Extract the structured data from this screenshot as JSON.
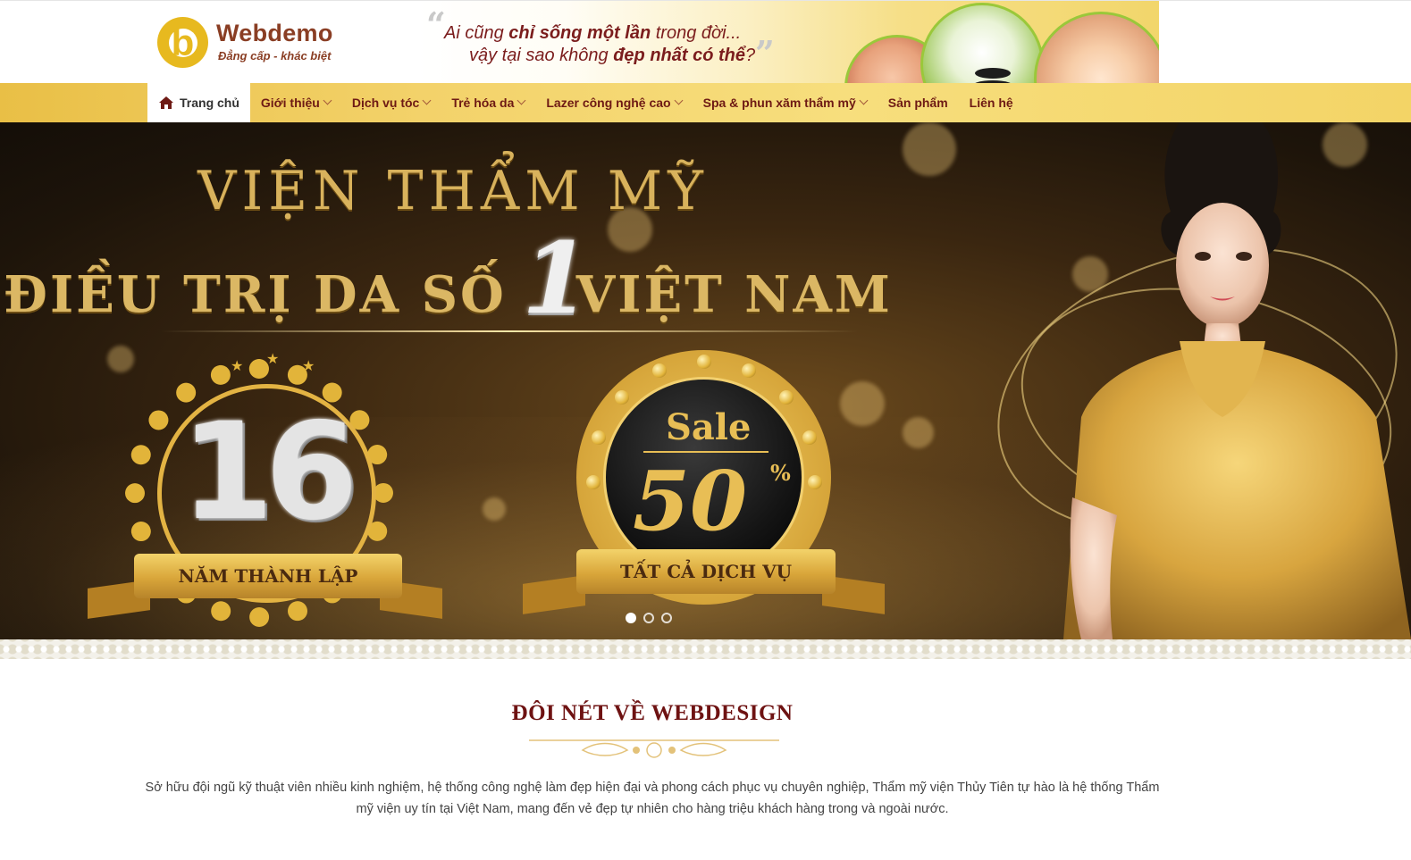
{
  "colors": {
    "brand_brown": "#8a3e24",
    "gold": "#e7b91f",
    "nav_text": "#6e1a14",
    "title_red": "#6e1212"
  },
  "header": {
    "logo_letter": "b",
    "logo_name": "Webdemo",
    "logo_slogan": "Đẳng cấp - khác biệt",
    "quote": {
      "open_mark": "“",
      "line1_a": "Ai cũng ",
      "line1_b": "chỉ sống một lần",
      "line1_c": " trong đời...",
      "line2_a": "vậy tại sao không ",
      "line2_b": "đẹp nhất có thể",
      "line2_c": "?",
      "close_mark": "”"
    }
  },
  "nav": {
    "items": [
      {
        "label": "Trang chủ",
        "icon": "home-icon",
        "active": true,
        "dropdown": false
      },
      {
        "label": "Giới thiệu",
        "active": false,
        "dropdown": true
      },
      {
        "label": "Dịch vụ tóc",
        "active": false,
        "dropdown": true
      },
      {
        "label": "Trẻ hóa da",
        "active": false,
        "dropdown": true
      },
      {
        "label": "Lazer công nghệ cao",
        "active": false,
        "dropdown": true
      },
      {
        "label": "Spa & phun xăm thẩm mỹ",
        "active": false,
        "dropdown": true
      },
      {
        "label": "Sản phẩm",
        "active": false,
        "dropdown": false
      },
      {
        "label": "Liên hệ",
        "active": false,
        "dropdown": false
      }
    ]
  },
  "hero": {
    "title_line1": "VIỆN THẨM MỸ",
    "title_line2_a": "ĐIỀU TRỊ DA SỐ",
    "title_line2_b": "VIỆT NAM",
    "rank_number": "1",
    "badge_years_number": "16",
    "badge_years_label": "NĂM THÀNH LẬP",
    "badge_sale_word": "Sale",
    "badge_sale_number": "50",
    "badge_sale_percent": "%",
    "badge_sale_label": "TẤT CẢ DỊCH VỤ",
    "slider": {
      "total": 3,
      "active": 1
    }
  },
  "about": {
    "title": "ĐÔI NÉT VỀ WEBDESIGN",
    "body": "Sở hữu đội ngũ kỹ thuật viên nhiều kinh nghiệm, hệ thống công nghệ làm đẹp hiện đại và phong cách phục vụ chuyên nghiệp, Thẩm mỹ viện Thủy Tiên tự hào là hệ thống Thẩm mỹ viện uy tín tại Việt Nam, mang đến vẻ đẹp tự nhiên cho hàng triệu khách hàng trong và ngoài nước."
  }
}
